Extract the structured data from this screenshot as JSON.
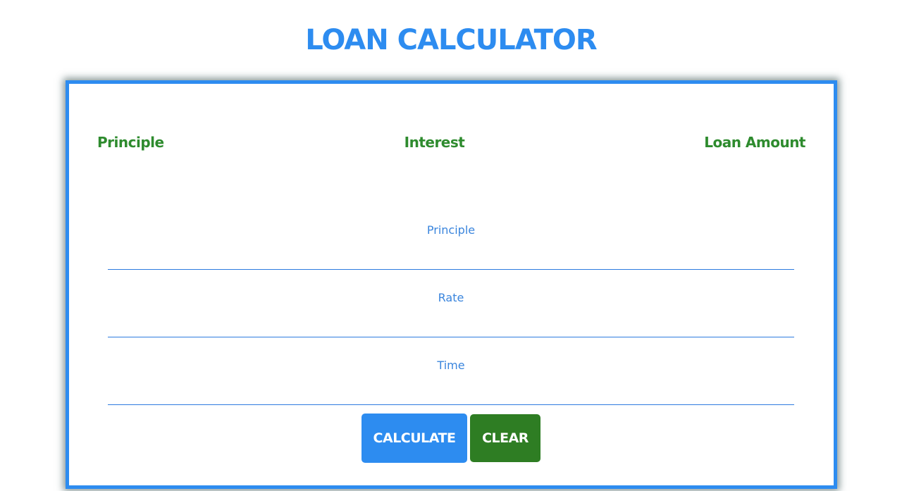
{
  "page": {
    "title": "LOAN CALCULATOR"
  },
  "summary": {
    "principle_label": "Principle",
    "interest_label": "Interest",
    "loan_amount_label": "Loan Amount"
  },
  "form": {
    "principle": {
      "label": "Principle",
      "value": ""
    },
    "rate": {
      "label": "Rate",
      "value": ""
    },
    "time": {
      "label": "Time",
      "value": ""
    }
  },
  "buttons": {
    "calculate_label": "CALCULATE",
    "clear_label": "CLEAR"
  },
  "colors": {
    "accent_blue": "#2d8cf0",
    "label_blue": "#3a85dd",
    "summary_green": "#2e8b2e",
    "clear_green": "#2e7d23"
  }
}
